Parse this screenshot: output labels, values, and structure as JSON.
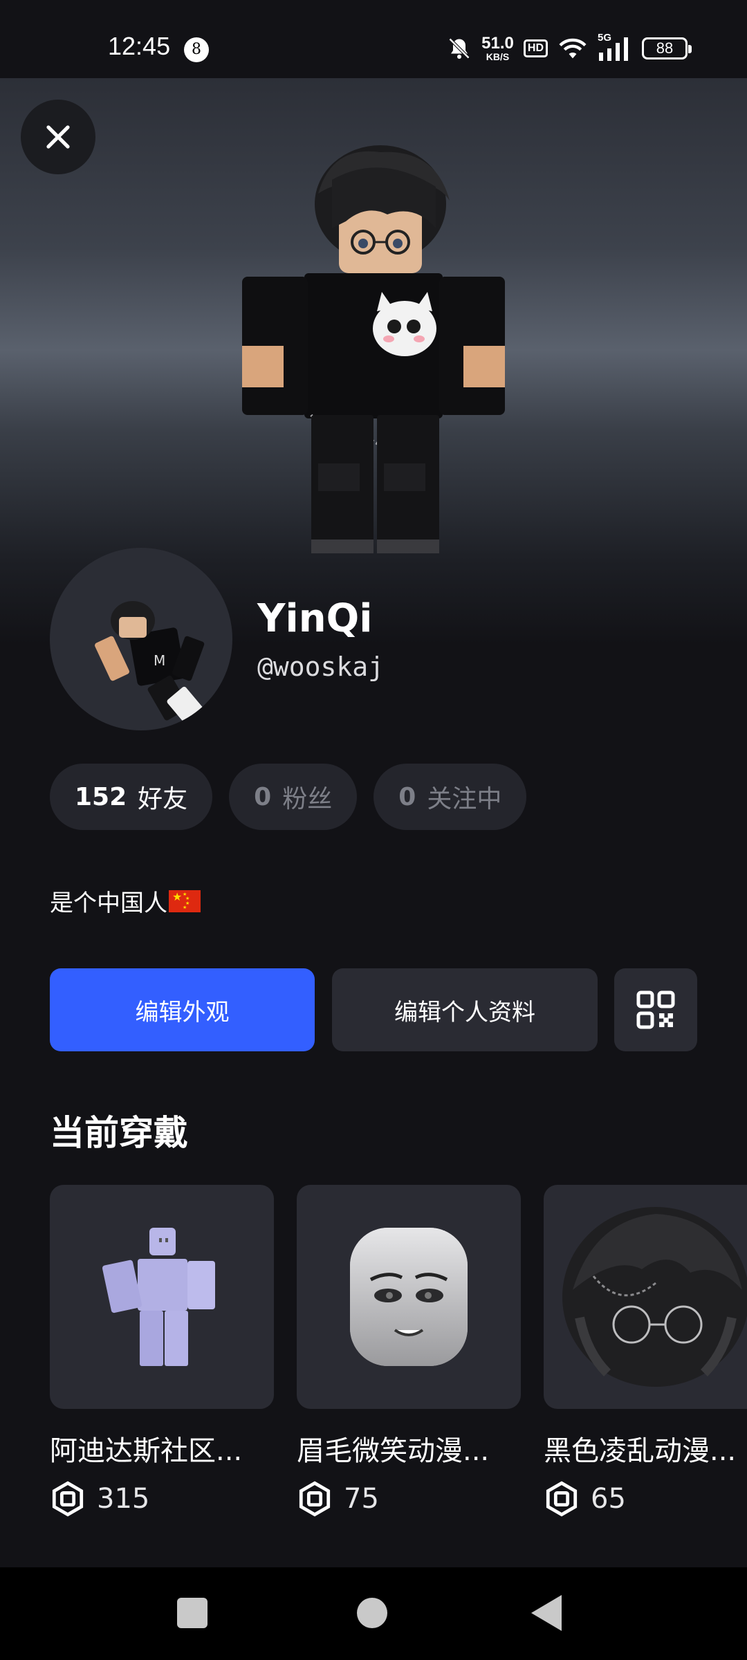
{
  "status_bar": {
    "time": "12:45",
    "notification_count": "8",
    "net_speed_value": "51.0",
    "net_speed_unit": "KB/S",
    "hd_label": "HD",
    "network_label": "5G",
    "battery": "88"
  },
  "profile": {
    "display_name": "YinQi",
    "username": "@wooskaj",
    "bio": "是个中国人",
    "bio_flag": "china-flag-icon"
  },
  "stats": [
    {
      "count": "152",
      "label": "好友"
    },
    {
      "count": "0",
      "label": "粉丝"
    },
    {
      "count": "0",
      "label": "关注中"
    }
  ],
  "actions": {
    "edit_avatar": "编辑外观",
    "edit_profile": "编辑个人资料",
    "qr_icon": "qr-code-icon"
  },
  "section_title": "当前穿戴",
  "items": [
    {
      "name": "阿迪达斯社区...",
      "price": "315",
      "icon": "robux-icon"
    },
    {
      "name": "眉毛微笑动漫...",
      "price": "75",
      "icon": "robux-icon"
    },
    {
      "name": "黑色凌乱动漫...",
      "price": "65",
      "icon": "robux-icon"
    }
  ],
  "colors": {
    "accent": "#335fff",
    "background": "#121216",
    "pill": "#24252c",
    "card": "#2a2b33"
  }
}
